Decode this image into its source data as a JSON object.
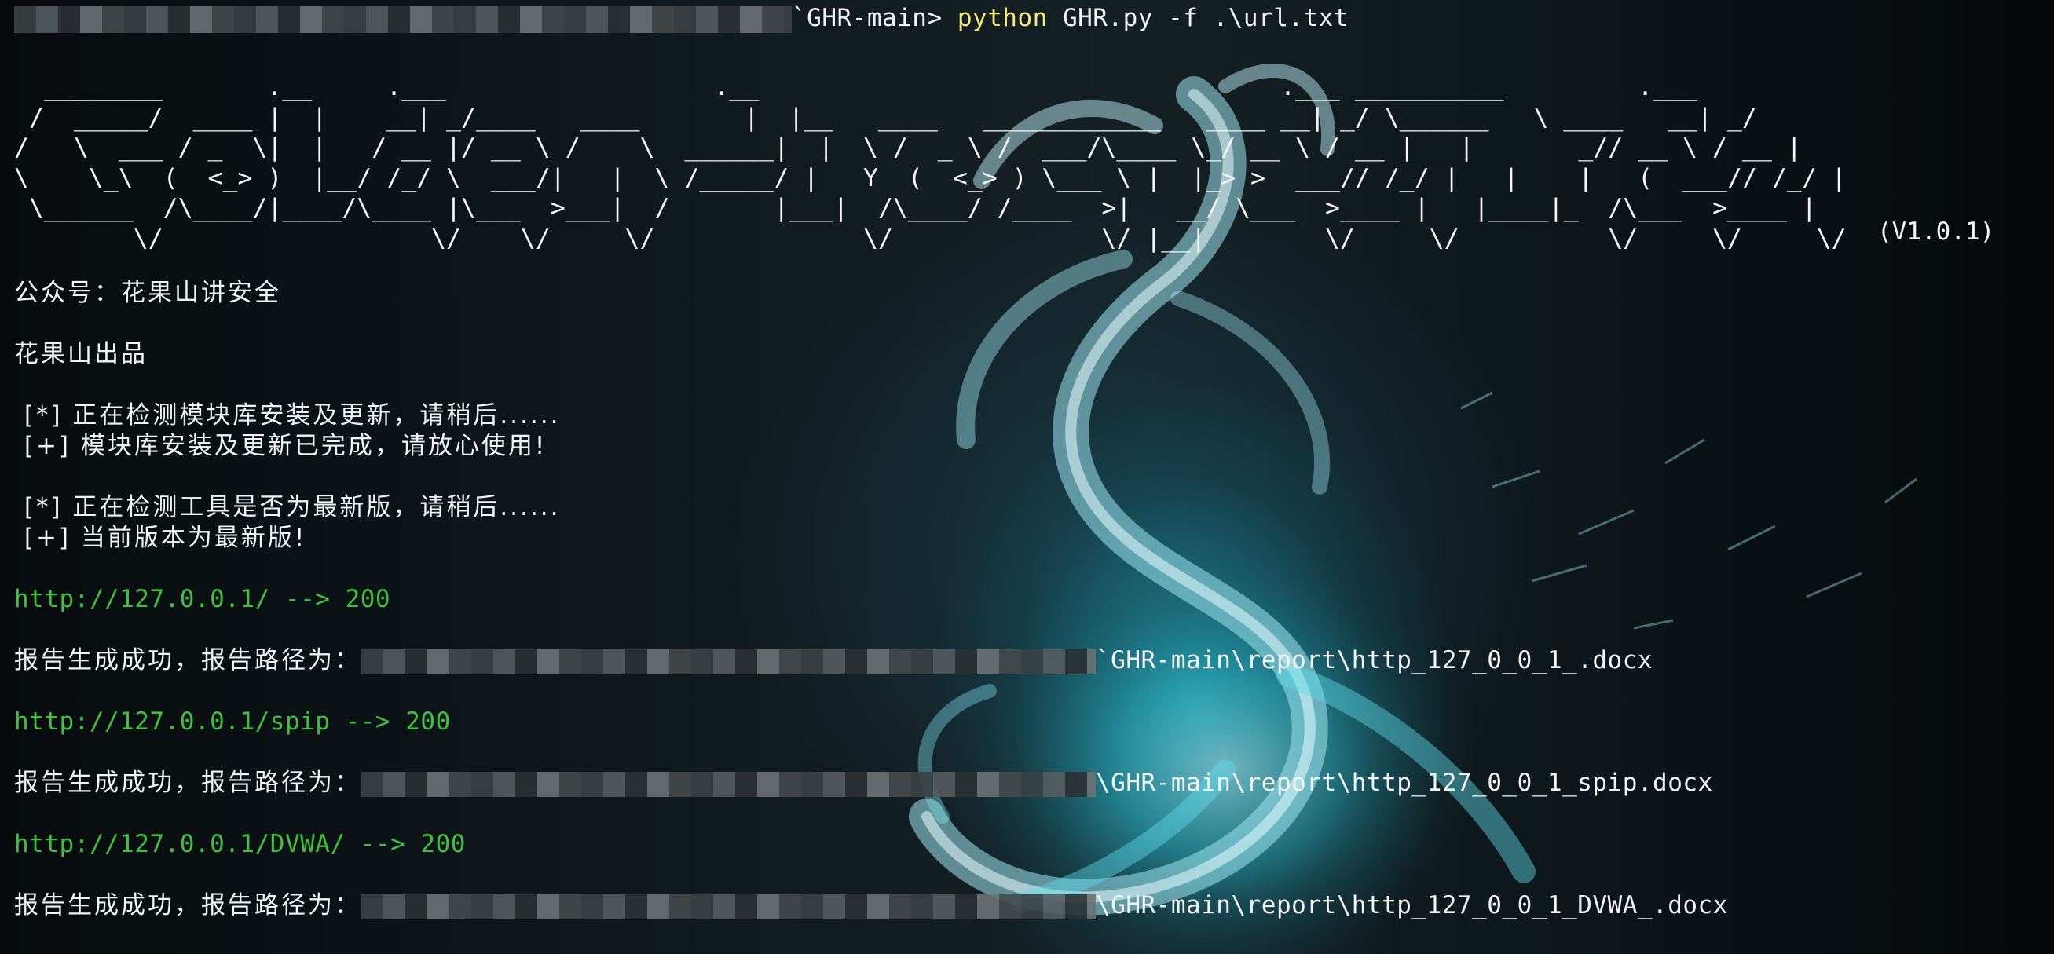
{
  "prompt": {
    "path_suffix": "`GHR-main>",
    "command": "python",
    "args": "GHR.py -f .\\url.txt"
  },
  "banner": {
    "ascii": "  ________       .__     .___                  .__                                   .___ __________         .___\n /  _____/  ____ |  |    __| _/____   ____       |  |__   ____   ____________   ____ __| _/ \\______   \\ ____   __| _/\n/   \\  ___ / _  \\|  |   / __ |/ __ \\ /    \\  ______|  |  \\ /  _ \\ /  ___/\\____ \\_/ __ \\ / __ |   |       _// __ \\ / __ |\n\\    \\_\\  (  <_> )  |__/ /_/ \\  ___/|   |  \\ /_____/ |   Y  (  <_> ) \\___ \\ |  |_> >  ___// /_/ |   |    |   (  ___// /_/ |\n \\______  /\\____/|____/\\____ |\\___  >___|  /       |___|  /\\____/ /____  >|   __/ \\___  >____ |   |____|_  /\\___  >____ |\n        \\/                  \\/    \\/     \\/              \\/              \\/ |__|        \\/     \\/          \\/     \\/     \\/",
    "version": "(V1.0.1)"
  },
  "info": {
    "wechat": "公众号：花果山讲安全",
    "credit": "花果山出品"
  },
  "status": {
    "check_modules": " [*] 正在检测模块库安装及更新，请稍后......",
    "modules_done": " [+] 模块库安装及更新已完成，请放心使用!",
    "check_version": " [*] 正在检测工具是否为最新版，请稍后......",
    "version_ok": " [+] 当前版本为最新版!"
  },
  "results": [
    {
      "url_line": "http://127.0.0.1/ --> 200",
      "report_label": "报告生成成功，报告路径为：",
      "report_path": "`GHR-main\\report\\http_127_0_0_1_.docx"
    },
    {
      "url_line": "http://127.0.0.1/spip --> 200",
      "report_label": "报告生成成功，报告路径为：",
      "report_path": "\\GHR-main\\report\\http_127_0_0_1_spip.docx"
    },
    {
      "url_line": "http://127.0.0.1/DVWA/ --> 200",
      "report_label": "报告生成成功，报告路径为：",
      "report_path": "\\GHR-main\\report\\http_127_0_0_1_DVWA_.docx"
    }
  ],
  "colors": {
    "url_green": "#3fbf3f",
    "command_yellow": "#f5e97a",
    "text_white": "#f2f4f5",
    "dragon_cyan": "#3fd6e6"
  },
  "background": {
    "image": "dragon-wallpaper"
  }
}
